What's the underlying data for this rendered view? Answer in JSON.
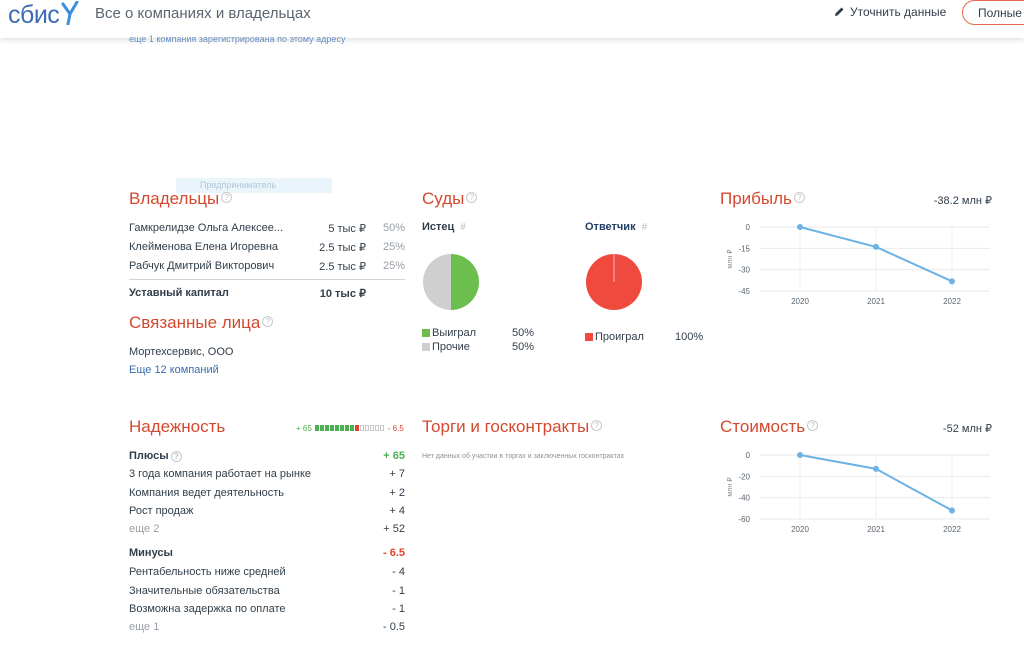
{
  "header": {
    "logo": "сбис",
    "title": "Все о компаниях и владельцах",
    "edit_label": "Уточнить данные",
    "full_button": "Полные"
  },
  "top_link": "еще 1 компания зарегистрирована по этому адресу",
  "ghost_text": "Предприниматель",
  "owners": {
    "title": "Владельцы",
    "rows": [
      {
        "name": "Гамкрелидзе Ольга Алексее...",
        "amount": "5 тыс ₽",
        "share": "50%"
      },
      {
        "name": "Клейменова Елена Игоревна",
        "amount": "2.5 тыс ₽",
        "share": "25%"
      },
      {
        "name": "Рабчук Дмитрий Викторович",
        "amount": "2.5 тыс ₽",
        "share": "25%"
      }
    ],
    "capital_label": "Уставный капитал",
    "capital_value": "10 тыс ₽"
  },
  "related": {
    "title": "Связанные лица",
    "item": "Мортехсервис, ООО",
    "more": "Еще 12 компаний"
  },
  "courts": {
    "title": "Суды",
    "plaintiff": {
      "label": "Истец",
      "hash": "#",
      "legend": [
        {
          "label": "Выиграл",
          "value": "50%",
          "color": "#6cbf4f"
        },
        {
          "label": "Прочие",
          "value": "50%",
          "color": "#cfcfcf"
        }
      ],
      "win_fraction": 0.5
    },
    "defendant": {
      "label": "Ответчик",
      "hash": "#",
      "legend": [
        {
          "label": "Проиграл",
          "value": "100%",
          "color": "#f04a3f"
        }
      ],
      "lose_fraction": 1.0
    }
  },
  "profit": {
    "title": "Прибыль",
    "value": "-38.2 млн ₽",
    "unit": "млн ₽"
  },
  "cost": {
    "title": "Стоимость",
    "value": "-52 млн ₽",
    "unit": "млн ₽"
  },
  "chart_data": [
    {
      "type": "line",
      "x": [
        "2020",
        "2021",
        "2022"
      ],
      "series": [
        {
          "values": [
            0,
            -14,
            -38.2
          ]
        }
      ],
      "yticks": [
        0,
        -15,
        -30,
        -45
      ],
      "ylim": [
        -45,
        0
      ],
      "ylabel": "млн ₽",
      "grid": true
    },
    {
      "type": "line",
      "x": [
        "2020",
        "2021",
        "2022"
      ],
      "series": [
        {
          "values": [
            0,
            -13,
            -52
          ]
        }
      ],
      "yticks": [
        0,
        -20,
        -40,
        -60
      ],
      "ylim": [
        -60,
        0
      ],
      "ylabel": "млн ₽",
      "grid": true
    }
  ],
  "reliability": {
    "title": "Надежность",
    "plus_score": "+ 65",
    "minus_score": "- 6.5",
    "pluses_label": "Плюсы",
    "pluses_total": "+ 65",
    "pluses": [
      {
        "label": "3 года компания работает на рынке",
        "value": "+ 7"
      },
      {
        "label": "Компания ведет деятельность",
        "value": "+ 2"
      },
      {
        "label": "Рост продаж",
        "value": "+ 4"
      }
    ],
    "pluses_more": "еще 2",
    "pluses_more_value": "+ 52",
    "minuses_label": "Минусы",
    "minuses_total": "- 6.5",
    "minuses": [
      {
        "label": "Рентабельность ниже средней",
        "value": "- 4"
      },
      {
        "label": "Значительные обязательства",
        "value": "- 1"
      },
      {
        "label": "Возможна задержка по оплате",
        "value": "- 1"
      }
    ],
    "minuses_more": "еще 1",
    "minuses_more_value": "- 0.5",
    "bar_green_segments": 8,
    "bar_red_segments": 1,
    "bar_empty_segments": 5
  },
  "tenders": {
    "title": "Торги и госконтракты",
    "note": "Нет данных об участии в торгах и заключенных госконтрактах"
  },
  "colors": {
    "accent": "#d4492e",
    "link": "#3a6cb0",
    "green": "#6cbf4f",
    "red": "#f04a3f",
    "line": "#6cb2e4"
  }
}
